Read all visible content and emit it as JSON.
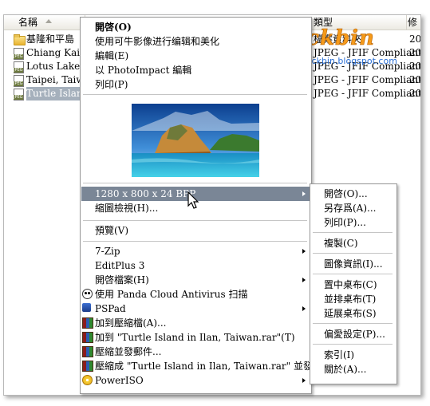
{
  "header": {
    "name_col": "名稱",
    "type_col": "類型",
    "date_col": "修"
  },
  "files": [
    {
      "name": "基隆和平島",
      "type": "檔案資料夾",
      "date": "20",
      "icon": "folder-icon"
    },
    {
      "name": "Chiang Kai-Sh",
      "type": "JPEG - JFIF Compliant",
      "date": "20",
      "icon": "jpeg-file-icon"
    },
    {
      "name": "Lotus Lake, K",
      "type": "JPEG - JFIF Compliant",
      "date": "20",
      "icon": "jpeg-file-icon"
    },
    {
      "name": "Taipei, Taiwan",
      "type": "JPEG - JFIF Compliant",
      "date": "20",
      "icon": "jpeg-file-icon"
    },
    {
      "name": "Turtle Island i",
      "type": "JPEG - JFIF Compliant",
      "date": "20",
      "icon": "jpeg-file-icon",
      "selected": true
    }
  ],
  "watermark": {
    "logo": "Jackbin",
    "url": "http://jackbin.blogspot.com"
  },
  "context_menu": {
    "top_items": [
      "開啓(O)",
      "使用可牛影像进行编辑和美化",
      "編輯(E)",
      "以 PhotoImpact 編輯",
      "列印(P)"
    ],
    "resolution_item": "1280 x 800 x 24 BPP",
    "thumbnail_view": "縮圖檢視(H)...",
    "preview": "預覽(V)",
    "tools": [
      {
        "label": "7-Zip",
        "submenu": true,
        "icon": ""
      },
      {
        "label": "EditPlus 3",
        "submenu": false,
        "icon": ""
      },
      {
        "label": "開啓檔案(H)",
        "submenu": true,
        "icon": ""
      },
      {
        "label": "使用 Panda Cloud Antivirus 扫描",
        "submenu": false,
        "icon": "panda-icon"
      },
      {
        "label": "PSPad",
        "submenu": true,
        "icon": "pspad-icon"
      },
      {
        "label": "加到壓縮檔(A)...",
        "submenu": false,
        "icon": "winrar-icon"
      },
      {
        "label": "加到 \"Turtle Island in Ilan, Taiwan.rar\"(T)",
        "submenu": false,
        "icon": "winrar-icon"
      },
      {
        "label": "壓縮並發郵件...",
        "submenu": false,
        "icon": "winrar-icon"
      },
      {
        "label": "壓縮成 \"Turtle Island in Ilan, Taiwan.rar\" 並發郵件",
        "submenu": false,
        "icon": "winrar-icon"
      },
      {
        "label": "PowerISO",
        "submenu": true,
        "icon": "poweriso-icon"
      }
    ]
  },
  "submenu": {
    "group1": [
      "開啓(O)...",
      "另存爲(A)...",
      "列印(P)..."
    ],
    "group2": [
      "複製(C)"
    ],
    "group3": [
      "圖像資訊(I)..."
    ],
    "group4": [
      "置中桌布(C)",
      "並排桌布(T)",
      "延展桌布(S)"
    ],
    "group5": [
      "偏愛設定(P)..."
    ],
    "group6": [
      "索引(I)",
      "關於(A)..."
    ]
  },
  "colors": {
    "highlight": "#7a8696",
    "watermark_orange": "#f59a1a",
    "watermark_url": "#2a6fd6"
  }
}
